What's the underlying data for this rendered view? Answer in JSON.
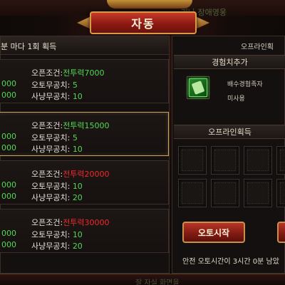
{
  "window": {
    "title": "자동",
    "top_dim_text": "기나 장애영웅",
    "bottom_dim_text": "잘 자실 화면을"
  },
  "left_panel": {
    "header": "분 마다 1회 획득",
    "tiers": [
      {
        "left_value": "000",
        "open_label": "오픈조건:",
        "open_value": "전투력7000",
        "open_color": "green",
        "auto_label": "오토무공치:",
        "auto_value": "5",
        "hunt_label": "사냥무공치:",
        "hunt_value": "10",
        "selected": false
      },
      {
        "left_value": "000",
        "open_label": "오픈조건:",
        "open_value": "전투력15000",
        "open_color": "green",
        "auto_label": "오토무공치:",
        "auto_value": "5",
        "hunt_label": "사냥무공치:",
        "hunt_value": "10",
        "selected": true
      },
      {
        "left_value": "000",
        "open_label": "오픈조건:",
        "open_value": "전투력20000",
        "open_color": "red",
        "auto_label": "오토무공치:",
        "auto_value": "10",
        "hunt_label": "사냥무공치:",
        "hunt_value": "20",
        "selected": false
      },
      {
        "left_value": "000",
        "open_label": "오픈조건:",
        "open_value": "전투력30000",
        "open_color": "red",
        "auto_label": "오토무공치:",
        "auto_value": "10",
        "hunt_label": "사냥무공치:",
        "hunt_value": "20",
        "selected": false
      }
    ]
  },
  "right_panel": {
    "top_label": "오프라인획",
    "exp_section": "경험치추가",
    "item": {
      "name": "배수경험족자",
      "status": "미사용",
      "icon": "scroll-icon"
    },
    "acquire_section": "오프라인획득",
    "auto_start_button": "오토시작",
    "safe_time_text": "안전 오토시간이 3시간 0분 남았"
  },
  "colors": {
    "green_value": "#52d852",
    "red_value": "#ee2a2a",
    "title_red": "#8c1a12",
    "gold_border": "#c9a45a"
  }
}
